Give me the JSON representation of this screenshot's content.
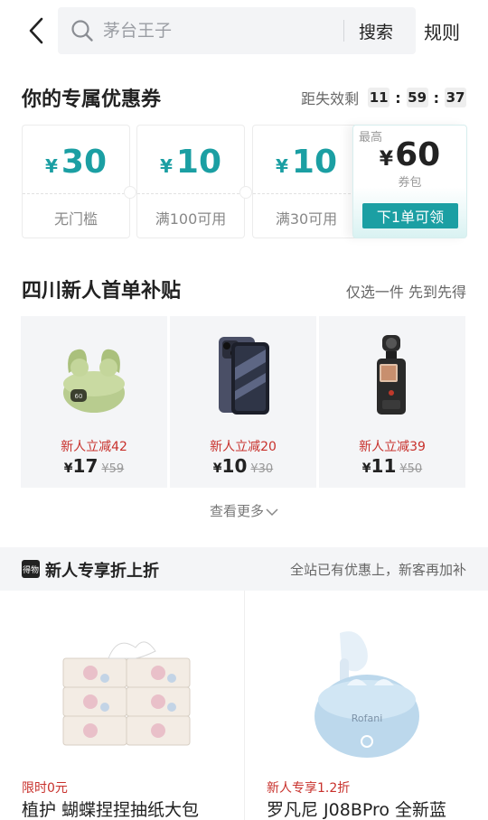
{
  "header": {
    "back_icon": "chevron-left-icon",
    "search_placeholder": "茅台王子",
    "search_label": "搜索",
    "rules_label": "规则"
  },
  "coupons": {
    "title": "你的专属优惠券",
    "expire_label": "距失效剩",
    "countdown": {
      "h": "11",
      "m": "59",
      "s": "37"
    },
    "items": [
      {
        "currency": "¥",
        "amount": "30",
        "condition": "无门槛"
      },
      {
        "currency": "¥",
        "amount": "10",
        "condition": "满100可用"
      },
      {
        "currency": "¥",
        "amount": "10",
        "condition": "满30可用"
      }
    ],
    "pack": {
      "top_label": "最高",
      "currency": "¥",
      "amount": "60",
      "label": "券包",
      "button": "下1单可领"
    },
    "accent_color": "#1b9fa3"
  },
  "subsidy": {
    "title": "四川新人首单补贴",
    "subtitle": "仅选一件 先到先得",
    "products": [
      {
        "icon": "earbuds-icon",
        "discount": "新人立减42",
        "currency": "¥",
        "price": "17",
        "original": "¥59"
      },
      {
        "icon": "phone-icon",
        "discount": "新人立减20",
        "currency": "¥",
        "price": "10",
        "original": "¥30"
      },
      {
        "icon": "camera-icon",
        "discount": "新人立减39",
        "currency": "¥",
        "price": "11",
        "original": "¥50"
      }
    ],
    "see_more": "查看更多"
  },
  "banner": {
    "icon_text": "得物",
    "title": "新人专享折上折",
    "subtitle": "全站已有优惠上，新客再加补"
  },
  "feed": [
    {
      "icon": "tissue-pack-icon",
      "tag": "限时0元",
      "name": "植护 蝴蝶捏捏抽纸大包"
    },
    {
      "icon": "earbuds-icon",
      "tag": "新人专享1.2折",
      "name": "罗凡尼 J08BPro 全新蓝"
    }
  ]
}
